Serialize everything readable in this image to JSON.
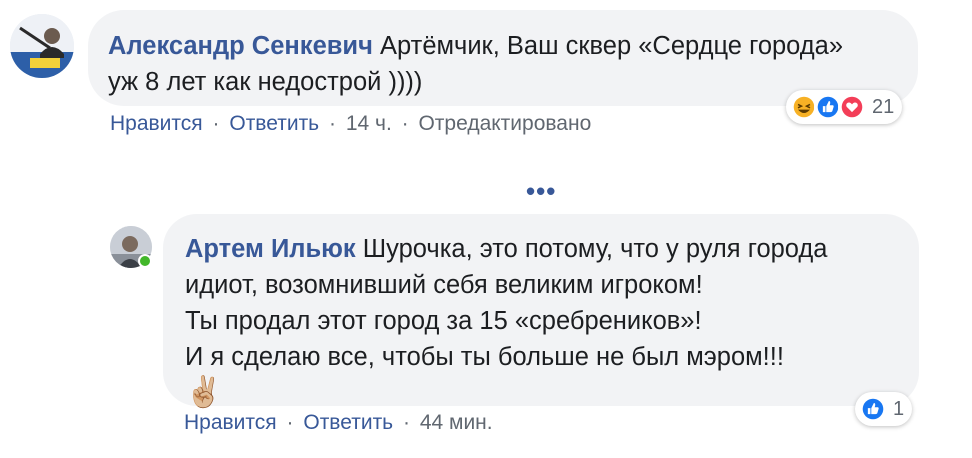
{
  "comments": [
    {
      "author": "Александр Сенкевич",
      "text_line1": " Артёмчик, Ваш сквер «Сердце города»",
      "text_line2": "уж 8 лет как недострой ))))",
      "actions": {
        "like": "Нравится",
        "reply": "Ответить",
        "time": "14 ч.",
        "edited": "Отредактировано",
        "separator": "·"
      },
      "reactions": {
        "icons": [
          "haha-icon",
          "like-icon",
          "love-icon"
        ],
        "count": "21"
      }
    },
    {
      "author": "Артем Ильюк",
      "text_line1": " Шурочка, это потому, что у руля города",
      "text_line2": "идиот, возомнивший себя великим игроком!",
      "text_line3": "Ты продал этот город за 15 «сребреников»!",
      "text_line4": "И я сделаю все, чтобы ты больше не был мэром!!!",
      "emoji": "✌🏼",
      "actions": {
        "like": "Нравится",
        "reply": "Ответить",
        "time": "44 мин.",
        "separator": "·"
      },
      "reactions": {
        "icons": [
          "like-icon"
        ],
        "count": "1"
      }
    }
  ],
  "more_replies": "•••",
  "colors": {
    "link": "#385898",
    "bubble": "#f2f3f5",
    "like": "#1877f2",
    "love": "#f33e58",
    "haha": "#f7b125",
    "online": "#42b72a"
  }
}
